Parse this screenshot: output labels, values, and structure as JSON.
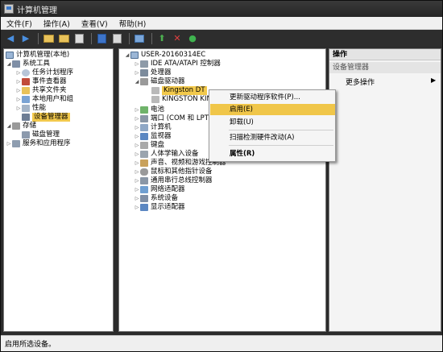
{
  "window": {
    "title": "计算机管理"
  },
  "menubar": {
    "items": [
      "文件(F)",
      "操作(A)",
      "查看(V)",
      "帮助(H)"
    ]
  },
  "toolbar": {
    "icons": [
      "back-arrow-icon",
      "forward-arrow-icon",
      "folder-icon",
      "folder-icon",
      "properties-icon",
      "help-icon",
      "scan-hardware-icon",
      "update-driver-icon",
      "uninstall-icon",
      "enable-icon"
    ]
  },
  "left_tree": {
    "root": "计算机管理(本地)",
    "system_tools": "系统工具",
    "task_scheduler": "任务计划程序",
    "event_viewer": "事件查看器",
    "shared_folders": "共享文件夹",
    "local_users": "本地用户和组",
    "performance": "性能",
    "device_manager": "设备管理器",
    "storage": "存储",
    "disk_management": "磁盘管理",
    "services": "服务和应用程序"
  },
  "device_tree": {
    "computer": "USER-20160314EC",
    "ide": "IDE ATA/ATAPI 控制器",
    "processor": "处理器",
    "disk_drives": "磁盘驱动器",
    "kingston1": "Kingston DT",
    "kingston2": "KINGSTON KIN",
    "battery": "电池",
    "ports": "端口 (COM 和 LPT)",
    "computer_cat": "计算机",
    "monitors": "监视器",
    "keyboards": "键盘",
    "hid": "人体学输入设备",
    "sound": "声音、视频和游戏控制器",
    "mice": "鼠标和其他指针设备",
    "usb": "通用串行总线控制器",
    "network": "网络适配器",
    "system": "系统设备",
    "display": "显示适配器"
  },
  "actions": {
    "header": "操作",
    "section": "设备管理器",
    "more": "更多操作"
  },
  "context_menu": {
    "update_driver": "更新驱动程序软件(P)...",
    "enable": "启用(E)",
    "uninstall": "卸载(U)",
    "scan": "扫描检测硬件改动(A)",
    "properties": "属性(R)"
  },
  "status": {
    "text": "启用所选设备。"
  },
  "colors": {
    "selection": "#f2c94c",
    "menu_highlight": "#f0c649"
  }
}
